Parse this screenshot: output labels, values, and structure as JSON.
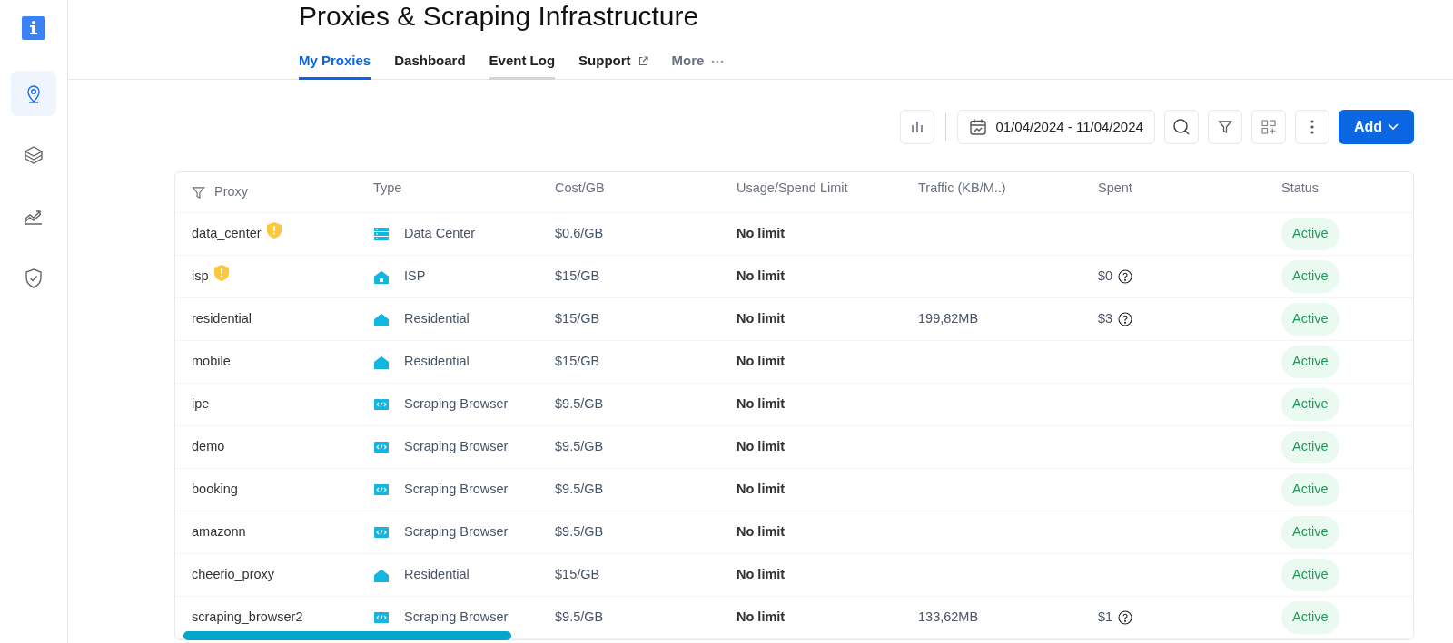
{
  "page_title": "Proxies & Scraping Infrastructure",
  "sidebar": {
    "items": [
      {
        "selected": true
      },
      {
        "selected": false
      },
      {
        "selected": false
      },
      {
        "selected": false
      }
    ]
  },
  "tabs": [
    {
      "label": "My Proxies",
      "selected": true,
      "hovered": false,
      "kind": "plain"
    },
    {
      "label": "Dashboard",
      "selected": false,
      "hovered": false,
      "kind": "plain"
    },
    {
      "label": "Event Log",
      "selected": false,
      "hovered": true,
      "kind": "plain"
    },
    {
      "label": "Support",
      "selected": false,
      "hovered": false,
      "kind": "external"
    },
    {
      "label": "More",
      "selected": false,
      "hovered": false,
      "kind": "more"
    }
  ],
  "toolbar": {
    "date_range": "01/04/2024 - 11/04/2024",
    "add_button": "Add"
  },
  "table": {
    "columns": [
      "Proxy",
      "Type",
      "Cost/GB",
      "Usage/Spend Limit",
      "Traffic (KB/M..)",
      "Spent",
      "Status"
    ],
    "rows": [
      {
        "proxy": "data_center",
        "warning": true,
        "kind": "datacenter",
        "type": "Data Center",
        "cost": "$0.6/GB",
        "limit": "No limit",
        "traffic": "",
        "spent": "",
        "status": "Active"
      },
      {
        "proxy": "isp",
        "warning": true,
        "kind": "isp",
        "type": "ISP",
        "cost": "$15/GB",
        "limit": "No limit",
        "traffic": "",
        "spent": "$0",
        "status": "Active"
      },
      {
        "proxy": "residential",
        "warning": false,
        "kind": "residential",
        "type": "Residential",
        "cost": "$15/GB",
        "limit": "No limit",
        "traffic": "199,82MB",
        "spent": "$3",
        "status": "Active"
      },
      {
        "proxy": "mobile",
        "warning": false,
        "kind": "residential",
        "type": "Residential",
        "cost": "$15/GB",
        "limit": "No limit",
        "traffic": "",
        "spent": "",
        "status": "Active"
      },
      {
        "proxy": "ipe",
        "warning": false,
        "kind": "browser",
        "type": "Scraping Browser",
        "cost": "$9.5/GB",
        "limit": "No limit",
        "traffic": "",
        "spent": "",
        "status": "Active"
      },
      {
        "proxy": "demo",
        "warning": false,
        "kind": "browser",
        "type": "Scraping Browser",
        "cost": "$9.5/GB",
        "limit": "No limit",
        "traffic": "",
        "spent": "",
        "status": "Active"
      },
      {
        "proxy": "booking",
        "warning": false,
        "kind": "browser",
        "type": "Scraping Browser",
        "cost": "$9.5/GB",
        "limit": "No limit",
        "traffic": "",
        "spent": "",
        "status": "Active"
      },
      {
        "proxy": "amazonn",
        "warning": false,
        "kind": "browser",
        "type": "Scraping Browser",
        "cost": "$9.5/GB",
        "limit": "No limit",
        "traffic": "",
        "spent": "",
        "status": "Active"
      },
      {
        "proxy": "cheerio_proxy",
        "warning": false,
        "kind": "residential",
        "type": "Residential",
        "cost": "$15/GB",
        "limit": "No limit",
        "traffic": "",
        "spent": "",
        "status": "Active"
      },
      {
        "proxy": "scraping_browser2",
        "warning": false,
        "kind": "browser",
        "type": "Scraping Browser",
        "cost": "$9.5/GB",
        "limit": "No limit",
        "traffic": "133,62MB",
        "spent": "$1",
        "status": "Active"
      }
    ]
  }
}
